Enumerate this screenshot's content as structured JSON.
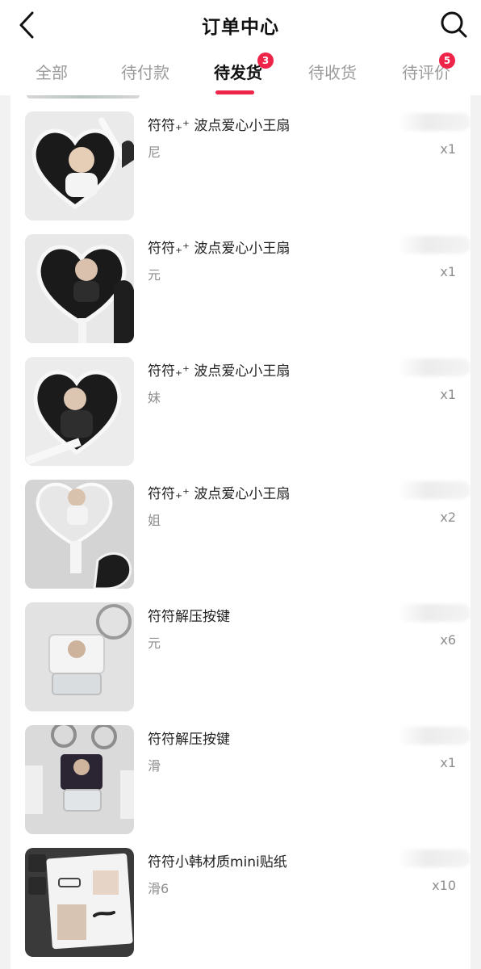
{
  "header": {
    "title": "订单中心",
    "back_icon": "chevron-left-icon",
    "search_icon": "search-icon"
  },
  "tabs": [
    {
      "label": "全部",
      "badge": ""
    },
    {
      "label": "待付款",
      "badge": ""
    },
    {
      "label": "待发货",
      "badge": "3",
      "active": true
    },
    {
      "label": "待收货",
      "badge": ""
    },
    {
      "label": "待评价",
      "badge": "5"
    }
  ],
  "accent_color": "#ee2449",
  "items": [
    {
      "title": "符符₊⁺ 波点爱心小王扇",
      "spec": "尼",
      "qty": "x1"
    },
    {
      "title": "符符₊⁺ 波点爱心小王扇",
      "spec": "元",
      "qty": "x1"
    },
    {
      "title": "符符₊⁺ 波点爱心小王扇",
      "spec": "妹",
      "qty": "x1"
    },
    {
      "title": "符符₊⁺ 波点爱心小王扇",
      "spec": "姐",
      "qty": "x2"
    },
    {
      "title": "符符解压按键",
      "spec": "元",
      "qty": "x6"
    },
    {
      "title": "符符解压按键",
      "spec": "滑",
      "qty": "x1"
    },
    {
      "title": "符符小韩材质mini贴纸",
      "spec": "滑6",
      "qty": "x10"
    }
  ]
}
